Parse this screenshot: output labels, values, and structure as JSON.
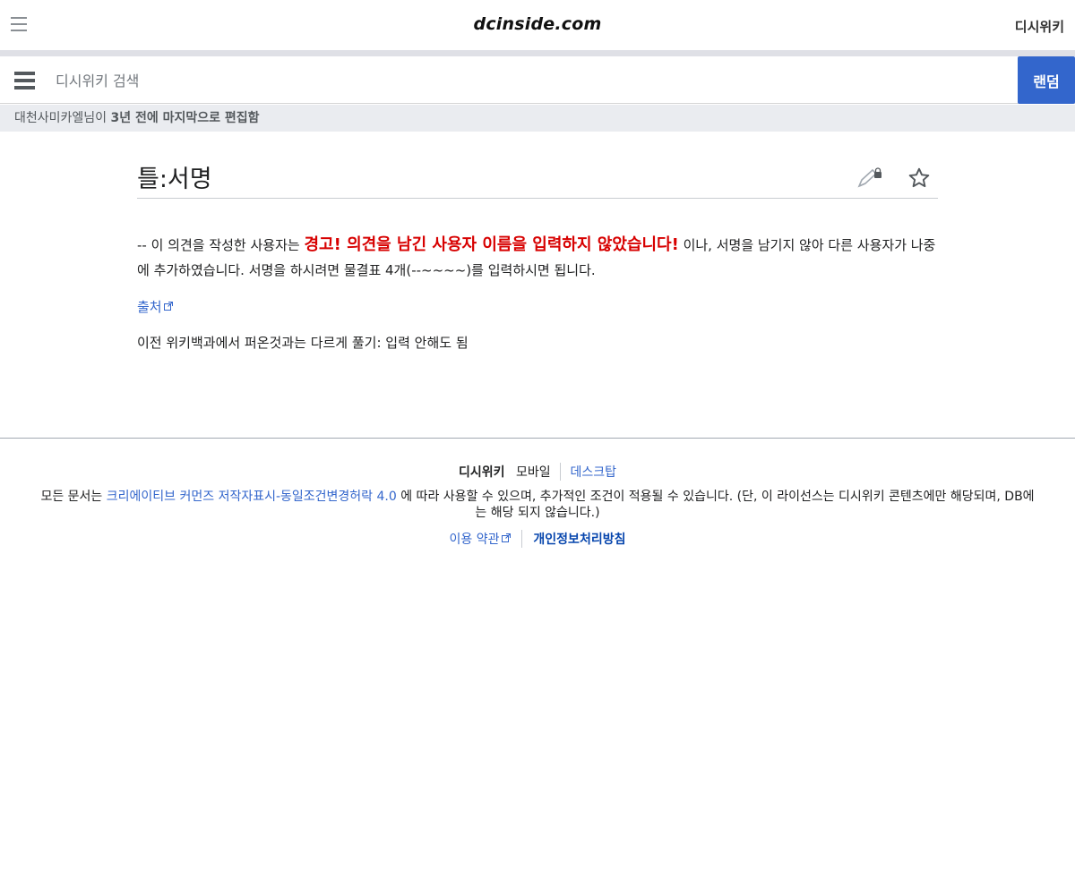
{
  "header": {
    "logo": "dcinside.com",
    "right_link": "디시위키"
  },
  "search": {
    "placeholder": "디시위키 검색",
    "random_label": "랜덤"
  },
  "last_edit": {
    "user": "대천사미카엘님이",
    "when": "3년 전에 마지막으로 편집함"
  },
  "page": {
    "title": "틀:서명",
    "para1_prefix": "-- 이 의견을 작성한 사용자는 ",
    "para1_warning": "경고! 의견을 남긴 사용자 이름을 입력하지 않았습니다!",
    "para1_suffix": " 이나, 서명을 남기지 않아 다른 사용자가 나중에 추가하였습니다. 서명을 하시려면 물결표 4개(--~~~~)를 입력하시면 됩니다.",
    "source_link": "출처",
    "para3": "이전 위키백과에서 퍼온것과는 다르게 풀기: 입력 안해도 됨"
  },
  "footer": {
    "brand": "디시위키",
    "mobile": "모바일",
    "desktop": "데스크탑",
    "license_prefix": "모든 문서는 ",
    "license_link": "크리에이티브 커먼즈 저작자표시-동일조건변경허락 4.0",
    "license_suffix": " 에 따라 사용할 수 있으며, 추가적인 조건이 적용될 수 있습니다. (단, 이 라이선스는 디시위키 콘텐츠에만 해당되며, DB에는 해당 되지 않습니다.)",
    "terms": "이용 약관",
    "privacy": "개인정보처리방침"
  },
  "colors": {
    "accent": "#3366cc",
    "warning": "#d70000"
  }
}
